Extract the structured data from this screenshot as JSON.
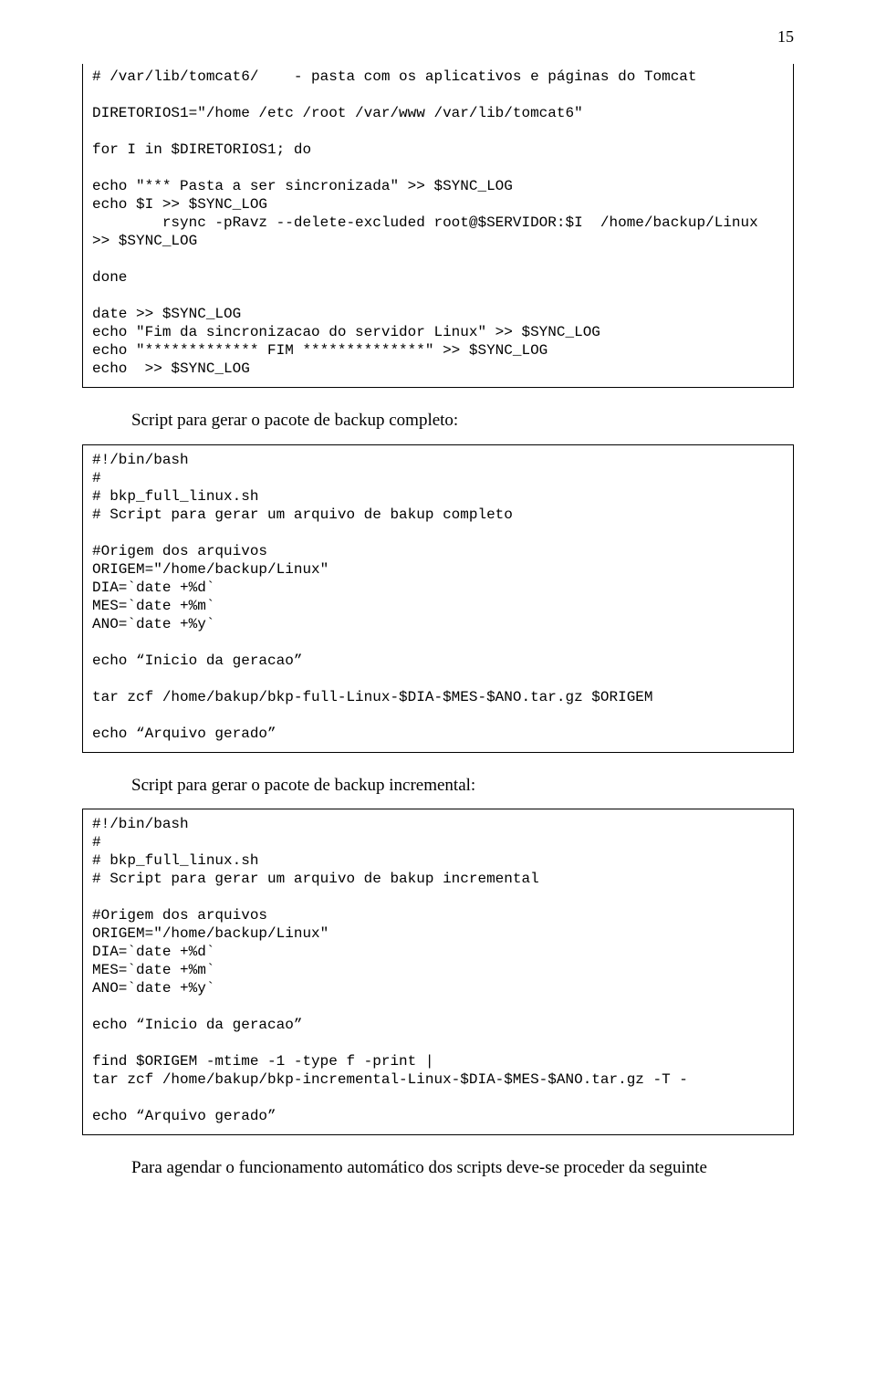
{
  "pageNumber": "15",
  "codeBlock1": "# /var/lib/tomcat6/    - pasta com os aplicativos e páginas do Tomcat\n\nDIRETORIOS1=\"/home /etc /root /var/www /var/lib/tomcat6\"\n\nfor I in $DIRETORIOS1; do\n\necho \"*** Pasta a ser sincronizada\" >> $SYNC_LOG\necho $I >> $SYNC_LOG\n        rsync -pRavz --delete-excluded root@$SERVIDOR:$I  /home/backup/Linux >> $SYNC_LOG\n\ndone\n\ndate >> $SYNC_LOG\necho \"Fim da sincronizacao do servidor Linux\" >> $SYNC_LOG\necho \"************* FIM **************\" >> $SYNC_LOG\necho  >> $SYNC_LOG",
  "caption1": "Script para gerar o pacote de backup completo:",
  "codeBlock2": "#!/bin/bash\n#\n# bkp_full_linux.sh\n# Script para gerar um arquivo de bakup completo\n\n#Origem dos arquivos\nORIGEM=\"/home/backup/Linux\"\nDIA=`date +%d`\nMES=`date +%m`\nANO=`date +%y`\n\necho “Inicio da geracao”\n\ntar zcf /home/bakup/bkp-full-Linux-$DIA-$MES-$ANO.tar.gz $ORIGEM\n\necho “Arquivo gerado”",
  "caption2": "Script para gerar o pacote de backup incremental:",
  "codeBlock3": "#!/bin/bash\n#\n# bkp_full_linux.sh\n# Script para gerar um arquivo de bakup incremental\n\n#Origem dos arquivos\nORIGEM=\"/home/backup/Linux\"\nDIA=`date +%d`\nMES=`date +%m`\nANO=`date +%y`\n\necho “Inicio da geracao”\n\nfind $ORIGEM -mtime -1 -type f -print |\ntar zcf /home/bakup/bkp-incremental-Linux-$DIA-$MES-$ANO.tar.gz -T -\n\necho “Arquivo gerado”",
  "finalParagraph": "Para agendar o funcionamento automático dos scripts deve-se proceder da seguinte"
}
